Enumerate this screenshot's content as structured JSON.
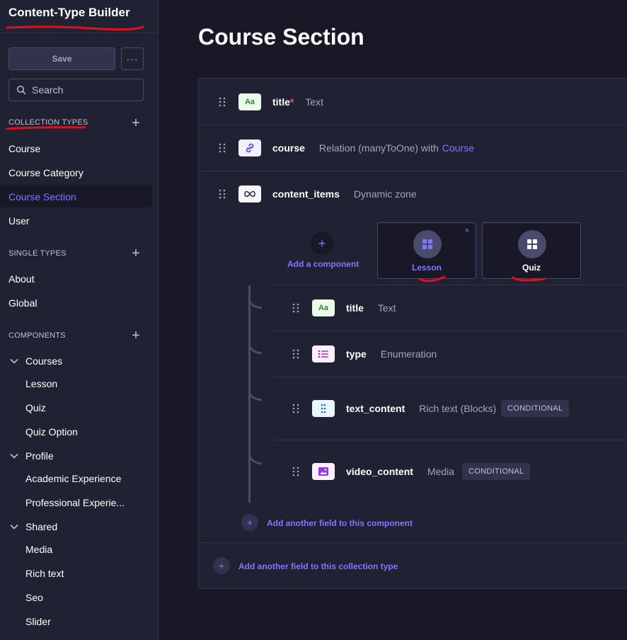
{
  "sidebar": {
    "title": "Content-Type Builder",
    "save_label": "Save",
    "more_label": "···",
    "search_label": "Search",
    "collection_types": {
      "heading": "COLLECTION TYPES",
      "items": [
        "Course",
        "Course Category",
        "Course Section",
        "User"
      ],
      "active": "Course Section"
    },
    "single_types": {
      "heading": "SINGLE TYPES",
      "items": [
        "About",
        "Global"
      ]
    },
    "components": {
      "heading": "COMPONENTS",
      "groups": [
        {
          "name": "Courses",
          "items": [
            "Lesson",
            "Quiz",
            "Quiz Option"
          ]
        },
        {
          "name": "Profile",
          "items": [
            "Academic Experience",
            "Professional Experie..."
          ]
        },
        {
          "name": "Shared",
          "items": [
            "Media",
            "Rich text",
            "Seo",
            "Slider"
          ]
        }
      ]
    }
  },
  "main": {
    "title": "Course Section",
    "fields": [
      {
        "name": "title",
        "required": "*",
        "type": "Text",
        "icon": "text-icon"
      },
      {
        "name": "course",
        "type": "Relation (manyToOne) with",
        "link": "Course",
        "icon": "relation-icon"
      },
      {
        "name": "content_items",
        "type": "Dynamic zone",
        "icon": "dynamic-zone-icon"
      }
    ],
    "dynamic_zone": {
      "add_component_label": "Add a component",
      "components": [
        {
          "name": "Lesson",
          "selected": true
        },
        {
          "name": "Quiz",
          "selected": false
        }
      ],
      "close_label": "×",
      "component_fields": [
        {
          "name": "title",
          "type": "Text",
          "icon": "text-icon"
        },
        {
          "name": "type",
          "type": "Enumeration",
          "icon": "enumeration-icon"
        },
        {
          "name": "text_content",
          "type": "Rich text (Blocks)",
          "badge": "CONDITIONAL",
          "icon": "blocks-icon"
        },
        {
          "name": "video_content",
          "type": "Media",
          "badge": "CONDITIONAL",
          "icon": "media-icon"
        }
      ],
      "add_field_to_component": "Add another field to this component"
    },
    "add_field_to_collection": "Add another field to this collection type"
  },
  "colors": {
    "accent": "#7b79ff",
    "annotation": "#e0101a",
    "text_icon_bg": "#eafbe7",
    "relation_icon_bg": "#f0f0ff",
    "enum_icon_bg": "#fdf4dc",
    "blocks_icon_bg": "#eaf5ff",
    "media_icon_bg": "#fcecea"
  }
}
